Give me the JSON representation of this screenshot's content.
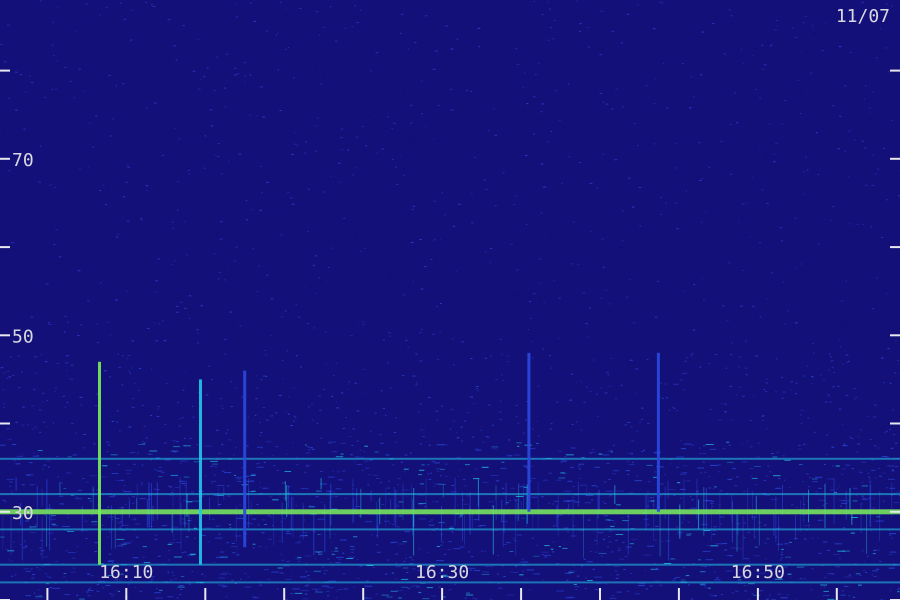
{
  "date_label": "11/07",
  "colors": {
    "background": "#14107a",
    "noise_dark": "#100c6a",
    "noise_light": "#3a3ad8",
    "low_band": "#2a4ae0",
    "signal_cyan": "#22c8e8",
    "signal_green": "#7af05a",
    "tick": "#e8e8f0",
    "text": "#d8d8e0"
  },
  "chart_data": {
    "type": "heatmap",
    "title": "",
    "xlabel": "",
    "ylabel": "",
    "x_range": [
      "16:02",
      "16:59"
    ],
    "y_range": [
      20,
      88
    ],
    "x_tick_labels": [
      "16:10",
      "16:30",
      "16:50"
    ],
    "y_tick_labels": [
      "70",
      "50",
      "30"
    ],
    "x_ticks": [
      "16:00",
      "16:05",
      "16:10",
      "16:15",
      "16:20",
      "16:25",
      "16:30",
      "16:35",
      "16:40",
      "16:45",
      "16:50",
      "16:55",
      "17:00"
    ],
    "y_ticks": [
      90,
      80,
      70,
      60,
      50,
      40,
      30,
      20
    ],
    "continuous_line": {
      "y": 30,
      "color": "signal_green"
    },
    "band_lines": [
      {
        "y": 36,
        "color": "signal_cyan"
      },
      {
        "y": 32,
        "color": "signal_cyan"
      },
      {
        "y": 28,
        "color": "signal_cyan"
      },
      {
        "y": 24,
        "color": "signal_cyan"
      },
      {
        "y": 22,
        "color": "signal_cyan"
      }
    ],
    "bursts": [
      {
        "time": "16:08.3",
        "y_top": 47,
        "y_bottom": 24,
        "color": "signal_green"
      },
      {
        "time": "16:14.7",
        "y_top": 45,
        "y_bottom": 24,
        "color": "signal_cyan"
      },
      {
        "time": "16:17.5",
        "y_top": 46,
        "y_bottom": 26,
        "color": "low_band"
      },
      {
        "time": "16:35.5",
        "y_top": 48,
        "y_bottom": 30,
        "color": "low_band"
      },
      {
        "time": "16:43.7",
        "y_top": 48,
        "y_bottom": 30,
        "color": "low_band"
      }
    ]
  }
}
